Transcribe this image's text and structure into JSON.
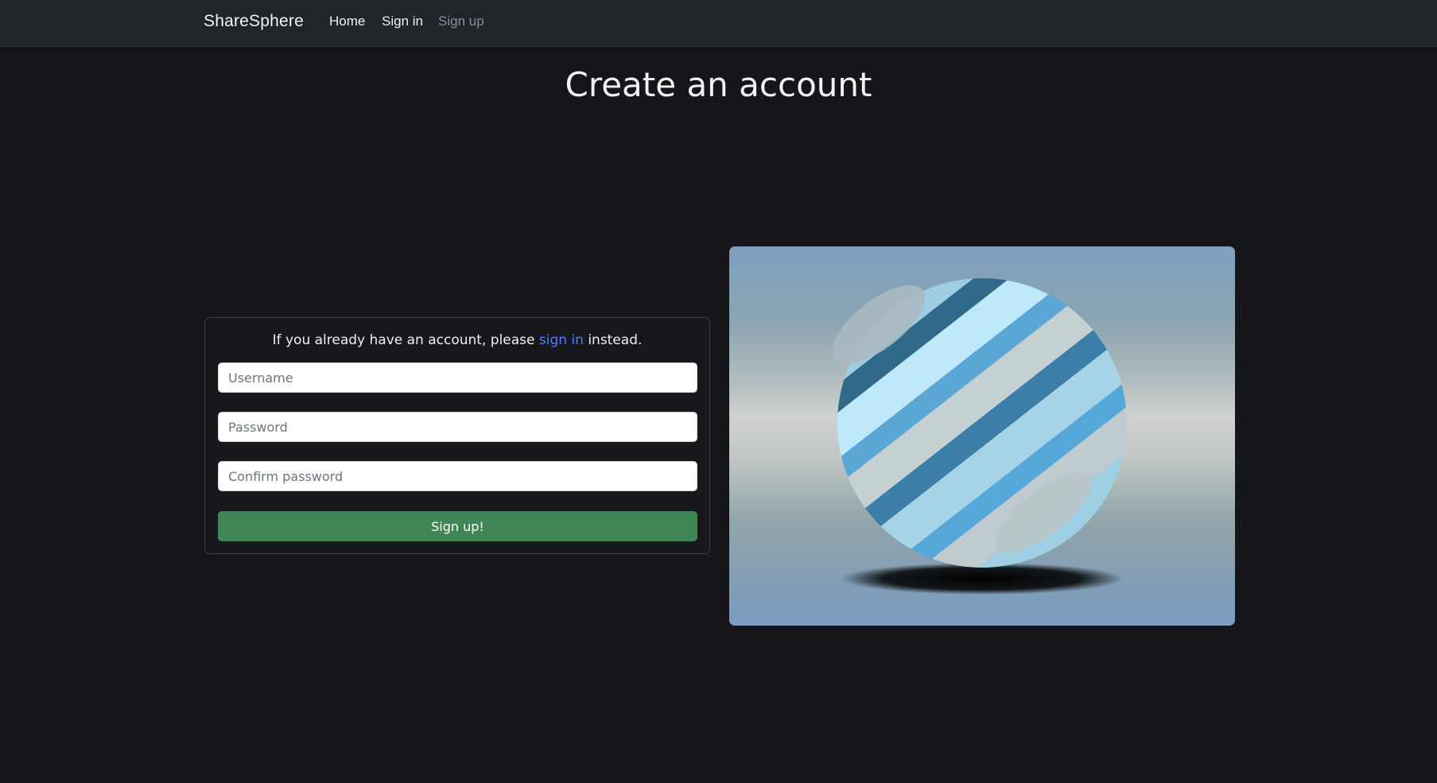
{
  "navbar": {
    "brand": "ShareSphere",
    "links": [
      {
        "label": "Home"
      },
      {
        "label": "Sign in"
      },
      {
        "label": "Sign up"
      }
    ]
  },
  "page": {
    "title": "Create an account"
  },
  "form": {
    "hint_prefix": "If you already have an account, please ",
    "hint_link": "sign in",
    "hint_suffix": " instead.",
    "username_placeholder": "Username",
    "password_placeholder": "Password",
    "confirm_placeholder": "Confirm password",
    "submit_label": "Sign up!",
    "submit_color": "#3e8654",
    "link_color": "#5a78ff"
  },
  "hero": {
    "icon": "ribbon-sphere-logo-icon"
  }
}
